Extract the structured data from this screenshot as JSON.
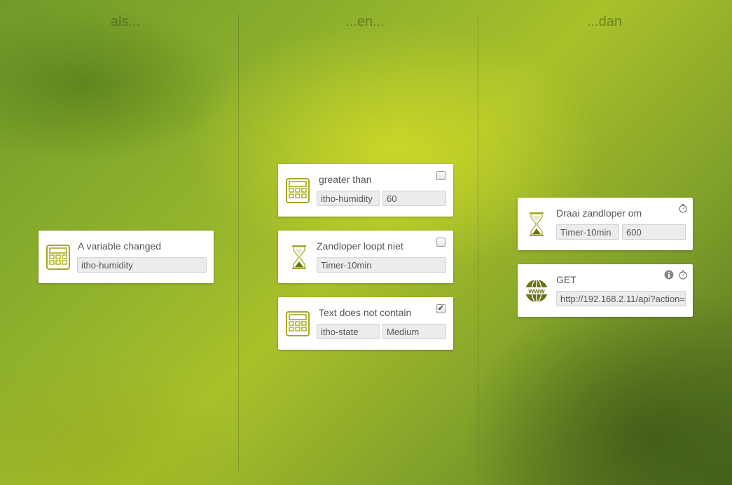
{
  "columns": {
    "if_title": "als...",
    "and_title": "...en...",
    "then_title": "...dan"
  },
  "triggers": [
    {
      "title": "A variable changed",
      "icon": "calculator-icon",
      "field1": "itho-humidity"
    }
  ],
  "conditions": [
    {
      "title": "greater than",
      "icon": "calculator-icon",
      "field1": "itho-humidity",
      "field2": "60",
      "inverted": false
    },
    {
      "title": "Zandloper loopt niet",
      "icon": "hourglass-icon",
      "field1": "Timer-10min",
      "inverted": false
    },
    {
      "title": "Text does not contain",
      "icon": "calculator-icon",
      "field1": "itho-state",
      "field2": "Medium",
      "inverted": true
    }
  ],
  "actions": [
    {
      "title": "Draai zandloper om",
      "icon": "hourglass-icon",
      "field1": "Timer-10min",
      "field2": "600"
    },
    {
      "title": "GET",
      "icon": "www-globe-icon",
      "field1": "http://192.168.2.11/api?action="
    }
  ],
  "icon_labels": {
    "www": "www"
  },
  "checkmark": "✔",
  "colors": {
    "icon_olive": "#a6a821",
    "icon_dark_olive": "#6b7318",
    "card_bg": "#ffffff",
    "field_bg": "#ececec"
  }
}
